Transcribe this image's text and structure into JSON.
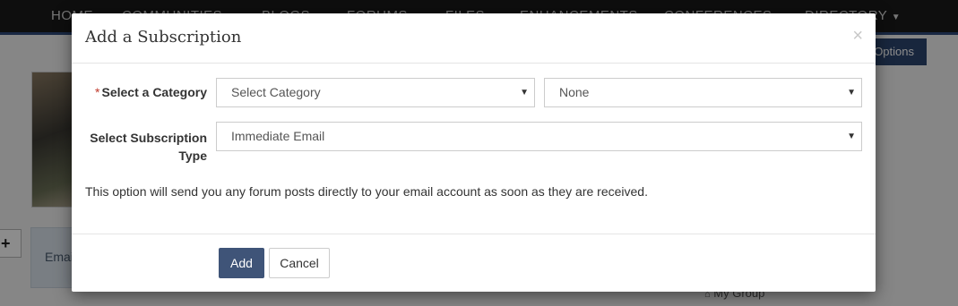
{
  "background": {
    "nav_items": [
      "HOME",
      "COMMUNITIES",
      "BLOGS",
      "FORUMS",
      "FILES",
      "ENHANCEMENTS",
      "CONFERENCES",
      "DIRECTORY"
    ],
    "options_button": "Options",
    "email_text": "Emai",
    "my_group": "My Group"
  },
  "modal": {
    "title": "Add a Subscription",
    "close_glyph": "×",
    "category_label": "Select a Category",
    "required_mark": "*",
    "category_select_value": "Select Category",
    "subcategory_select_value": "None",
    "type_label_line1": "Select Subscription",
    "type_label_line2": "Type",
    "type_select_value": "Immediate Email",
    "description": "This option will send you any forum posts directly to your email account as soon as they are received.",
    "add_button": "Add",
    "cancel_button": "Cancel"
  },
  "colors": {
    "primary_button": "#3f5478",
    "required_asterisk": "#c0392b",
    "nav_bar": "#1a1a1a"
  }
}
